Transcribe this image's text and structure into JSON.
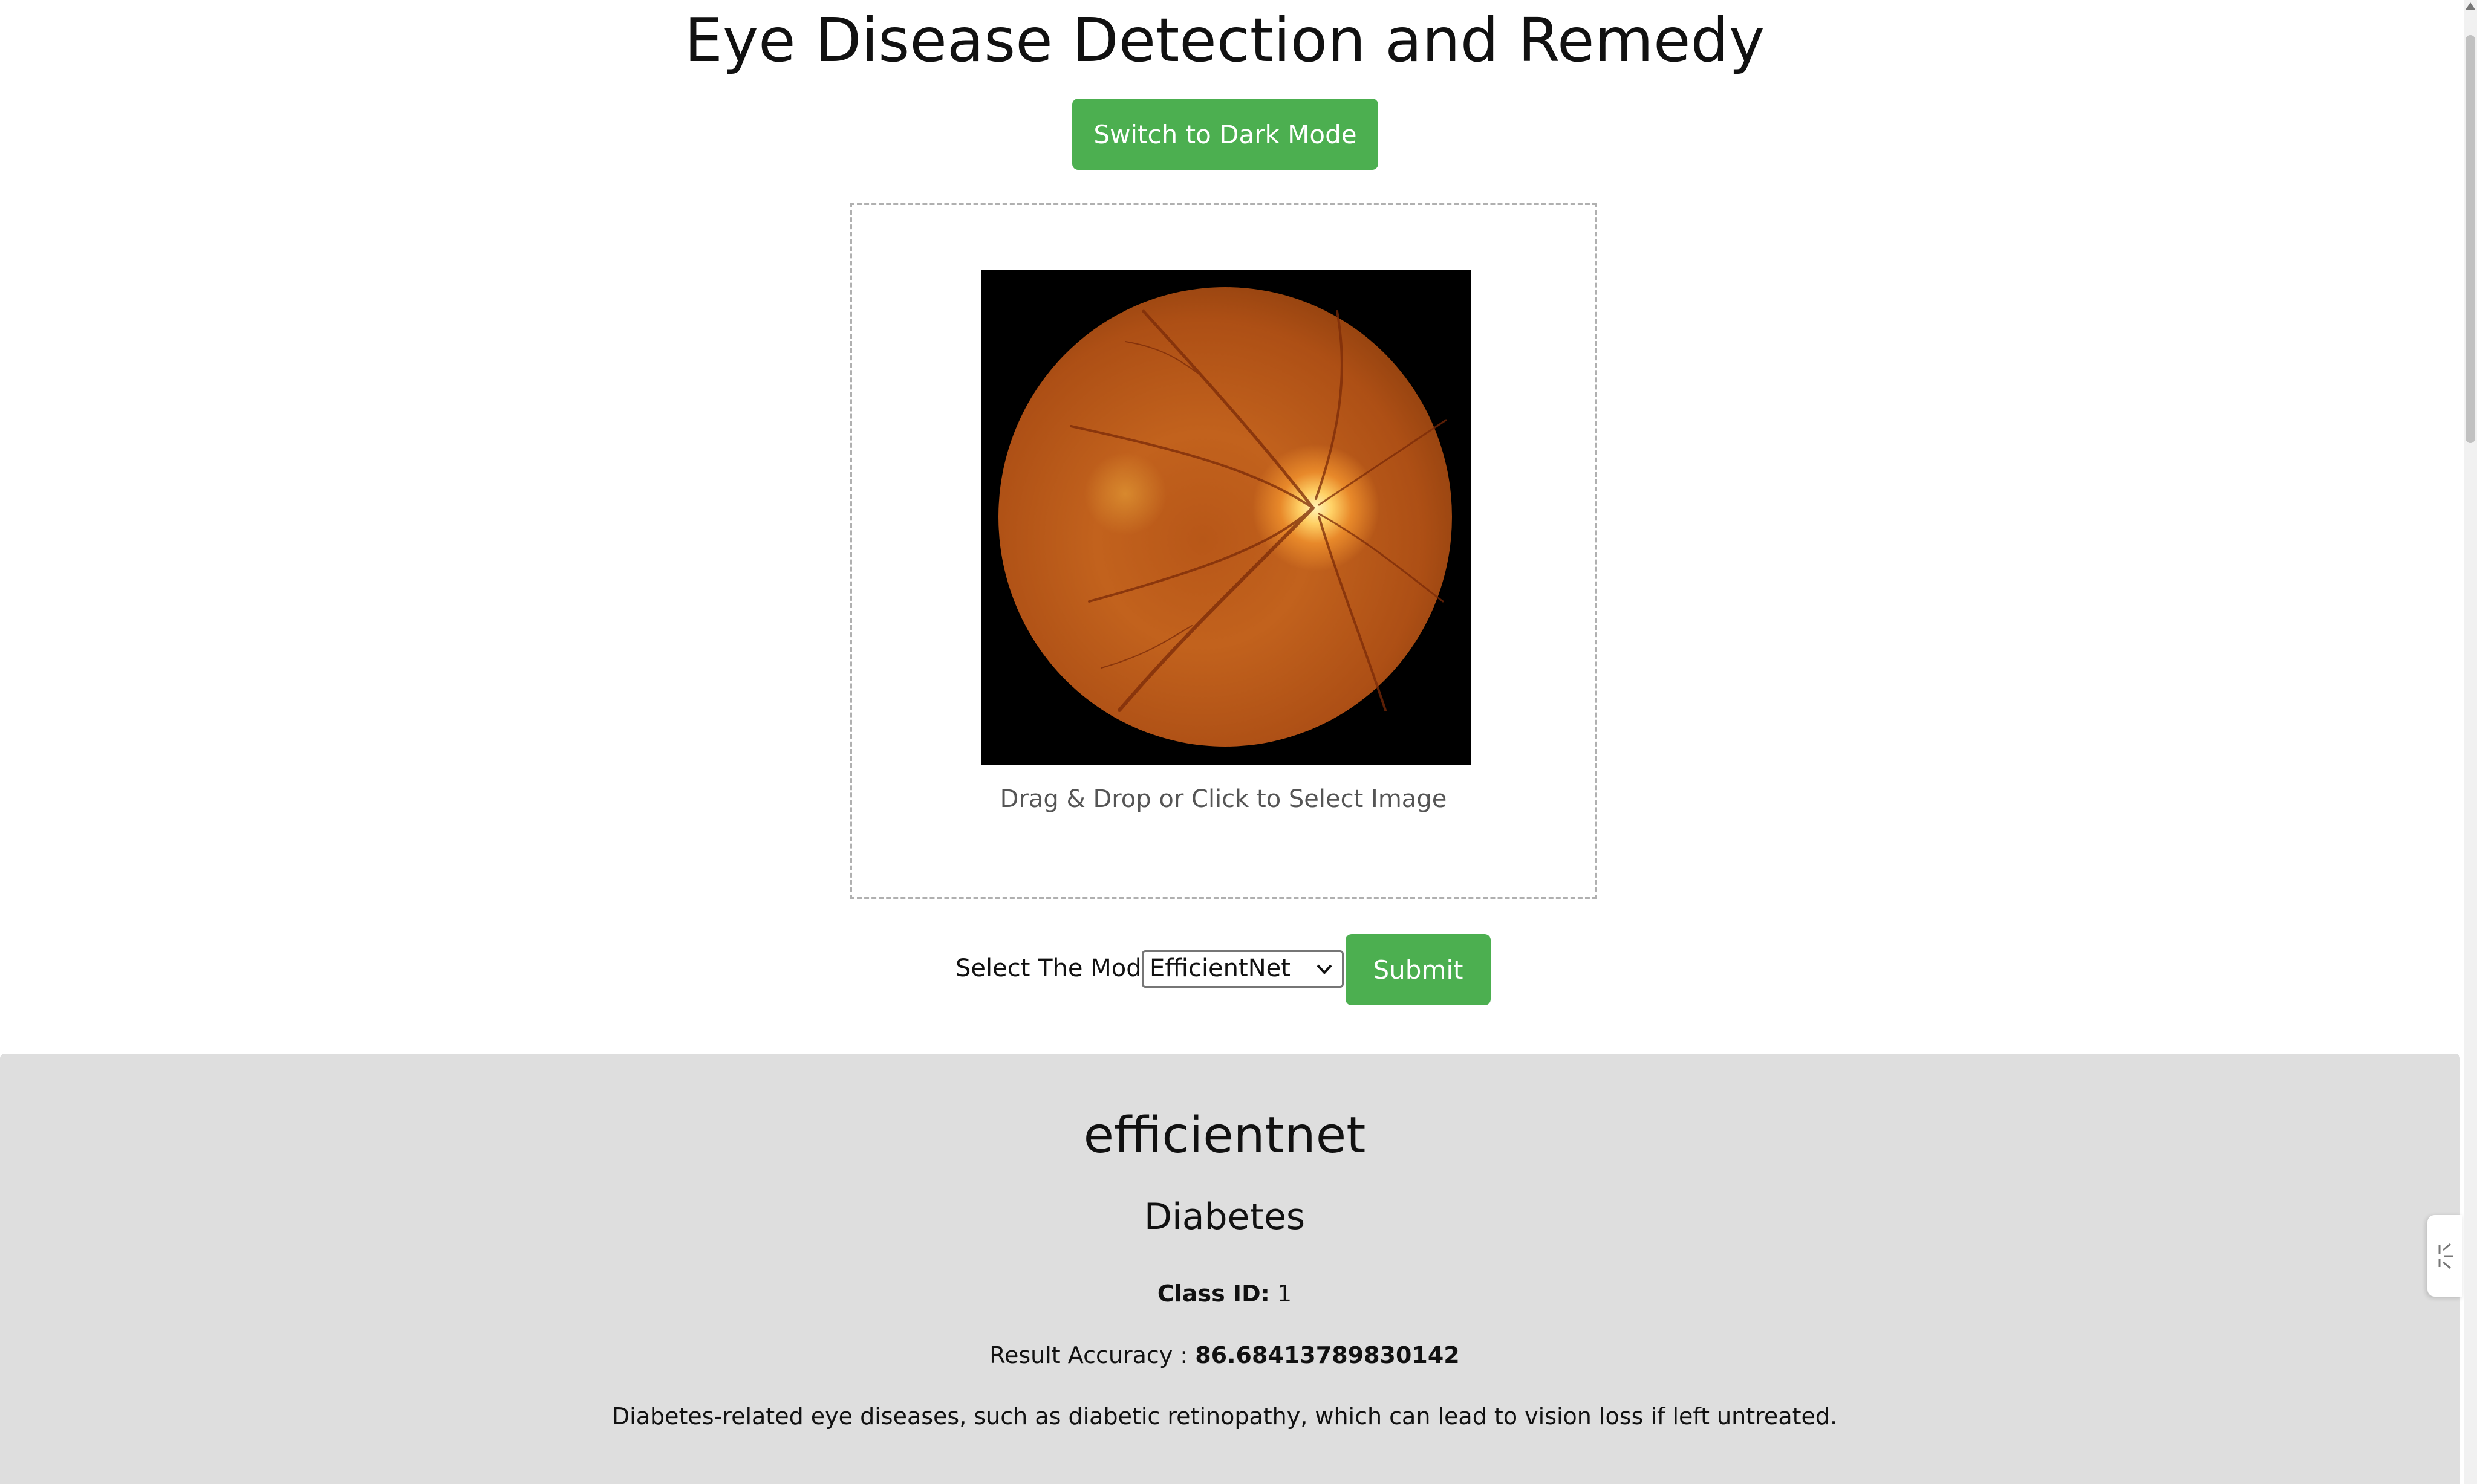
{
  "header": {
    "title": "Eye Disease Detection and Remedy",
    "dark_mode_label": "Switch to Dark Mode"
  },
  "upload": {
    "hint": "Drag & Drop or Click to Select Image",
    "preview_alt": "retina fundus image"
  },
  "model": {
    "label": "Select The Model",
    "selected": "EfficientNet",
    "submit_label": "Submit"
  },
  "result": {
    "model_name": "efficientnet",
    "disease": "Diabetes",
    "class_id_label": "Class ID:",
    "class_id": "1",
    "accuracy_label": "Result Accuracy :",
    "accuracy": "86.68413789830142",
    "description": "Diabetes-related eye diseases, such as diabetic retinopathy, which can lead to vision loss if left untreated."
  },
  "colors": {
    "accent": "#4caf50",
    "result_bg": "#dedede",
    "page_bg": "#ffffff"
  },
  "icons": {
    "dropdown": "chevron-down-icon",
    "side_tab": "collapse-icon"
  }
}
